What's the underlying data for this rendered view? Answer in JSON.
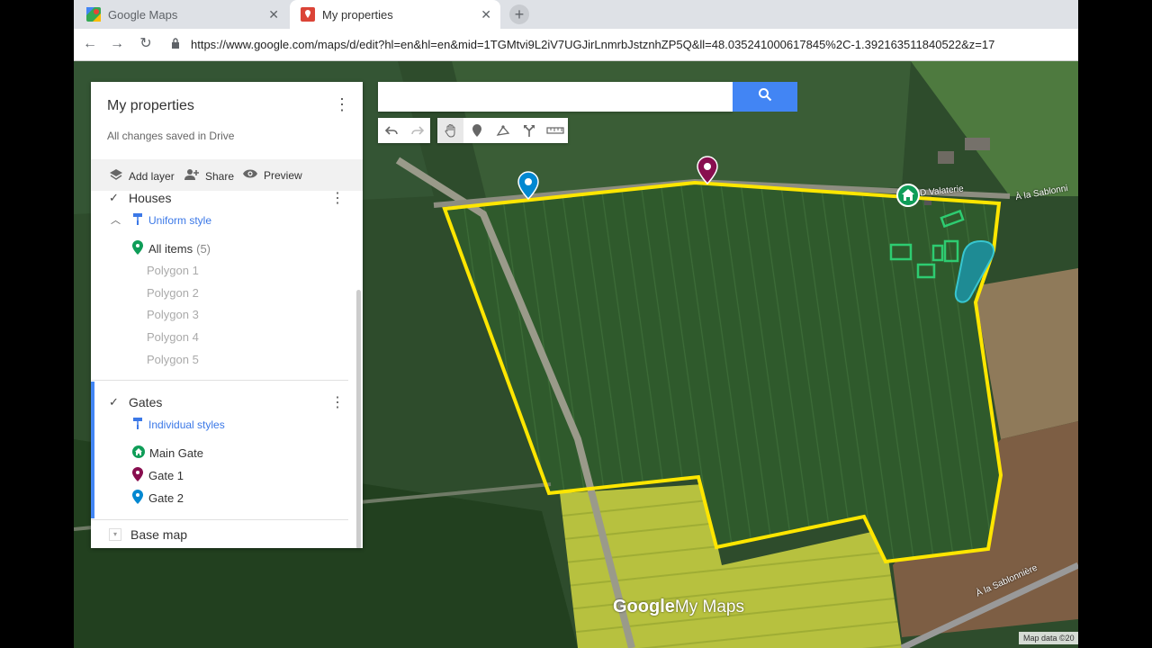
{
  "browser": {
    "tabs": [
      {
        "title": "Google Maps",
        "active": false
      },
      {
        "title": "My properties",
        "active": true
      }
    ],
    "url": "https://www.google.com/maps/d/edit?hl=en&hl=en&mid=1TGMtvi9L2iV7UGJirLnmrbJstznhZP5Q&ll=48.035241000617845%2C-1.392163511840522&z=17"
  },
  "panel": {
    "title": "My properties",
    "subtitle": "All changes saved in Drive",
    "toolbar": {
      "add_layer": "Add layer",
      "share": "Share",
      "preview": "Preview"
    },
    "layers": [
      {
        "name": "Houses",
        "style": "Uniform style",
        "all_items": "All items",
        "count": "(5)",
        "items": [
          "Polygon 1",
          "Polygon 2",
          "Polygon 3",
          "Polygon 4",
          "Polygon 5"
        ]
      },
      {
        "name": "Gates",
        "style": "Individual styles",
        "items": [
          "Main Gate",
          "Gate 1",
          "Gate 2"
        ]
      }
    ],
    "base_map": "Base map"
  },
  "map": {
    "road_labels": [
      "À la Sablonni",
      "À la Sablonnière",
      "D Valaterie"
    ],
    "logo_google": "Google",
    "logo_mymaps": "My Maps",
    "attribution": "Map data ©20"
  },
  "colors": {
    "boundary": "#ffe600",
    "gate_main": "#0f9d58",
    "gate_1": "#880e4f",
    "gate_2": "#0288d1",
    "accent": "#4285f4"
  }
}
